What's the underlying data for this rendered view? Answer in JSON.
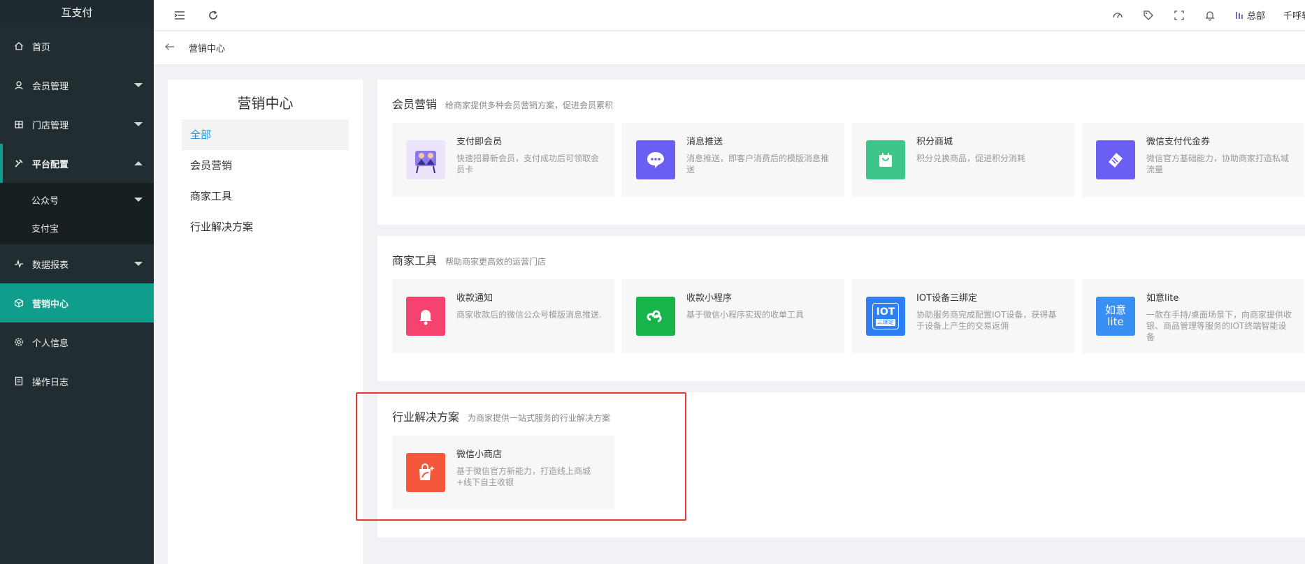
{
  "app": {
    "title": "互支付"
  },
  "sidebar": {
    "items": [
      {
        "label": "首页",
        "icon": "home-icon"
      },
      {
        "label": "会员管理",
        "icon": "user-icon"
      },
      {
        "label": "门店管理",
        "icon": "store-icon"
      },
      {
        "label": "平台配置",
        "icon": "tools-icon"
      },
      {
        "label": "数据报表",
        "icon": "chart-icon"
      },
      {
        "label": "营销中心",
        "icon": "cube-icon"
      },
      {
        "label": "个人信息",
        "icon": "gear-icon"
      },
      {
        "label": "操作日志",
        "icon": "log-icon"
      }
    ],
    "submenu": [
      {
        "label": "公众号"
      },
      {
        "label": "支付宝"
      }
    ],
    "active_color": "#0e9e8b"
  },
  "header": {
    "hq_label": "总部",
    "user_label": "千呼软"
  },
  "breadcrumb": {
    "current": "营销中心"
  },
  "categories": {
    "title": "营销中心",
    "items": [
      "全部",
      "会员营销",
      "商家工具",
      "行业解决方案"
    ],
    "active_color": "#1e9bd7"
  },
  "sections": [
    {
      "title": "会员营销",
      "subtitle": "给商家提供多种会员营销方案，促进会员累积",
      "cards": [
        {
          "name": "支付即会员",
          "desc": "快速招募新会员，支付成功后可领取会员卡",
          "icon": "member-illustration-icon",
          "color": "#ece4fb"
        },
        {
          "name": "消息推送",
          "desc": "消息推送，即客户消费后的模版消息推送",
          "icon": "chat-bubble-icon",
          "color": "#6b5ef3"
        },
        {
          "name": "积分商城",
          "desc": "积分兑换商品，促进积分消耗",
          "icon": "shopping-bag-icon",
          "color": "#3fc48a"
        },
        {
          "name": "微信支付代金券",
          "desc": "微信官方基础能力，协助商家打造私域流量",
          "icon": "coupon-icon",
          "color": "#6b5ef3"
        }
      ]
    },
    {
      "title": "商家工具",
      "subtitle": "帮助商家更高效的运营门店",
      "cards": [
        {
          "name": "收款通知",
          "desc": "商家收款后的微信公众号模版消息推送.",
          "icon": "bell-icon",
          "color": "#f4436e"
        },
        {
          "name": "收款小程序",
          "desc": "基于微信小程序实现的收单工具",
          "icon": "mini-program-icon",
          "color": "#16b44a"
        },
        {
          "name": "IOT设备三绑定",
          "desc": "协助服务商完成配置IOT设备，获得基于设备上产生的交易返佣",
          "icon": "iot-icon",
          "icon_text": "IOT",
          "icon_sub": "三绑定",
          "color": "#2d7ff3"
        },
        {
          "name": "如意lite",
          "desc": "一款在手持/桌面场景下，向商家提供收银、商品管理等服务的IOT终端智能设备",
          "icon": "ruyi-icon",
          "icon_text": "如意",
          "icon_sub": "lite",
          "color": "#3a8ff5"
        }
      ]
    },
    {
      "title": "行业解决方案",
      "subtitle": "为商家提供一站式服务的行业解决方案",
      "cards": [
        {
          "name": "微信小商店",
          "desc": "基于微信官方新能力，打造线上商城+线下自主收银",
          "icon": "shop-bag-icon",
          "color": "#f5573b"
        }
      ]
    }
  ]
}
